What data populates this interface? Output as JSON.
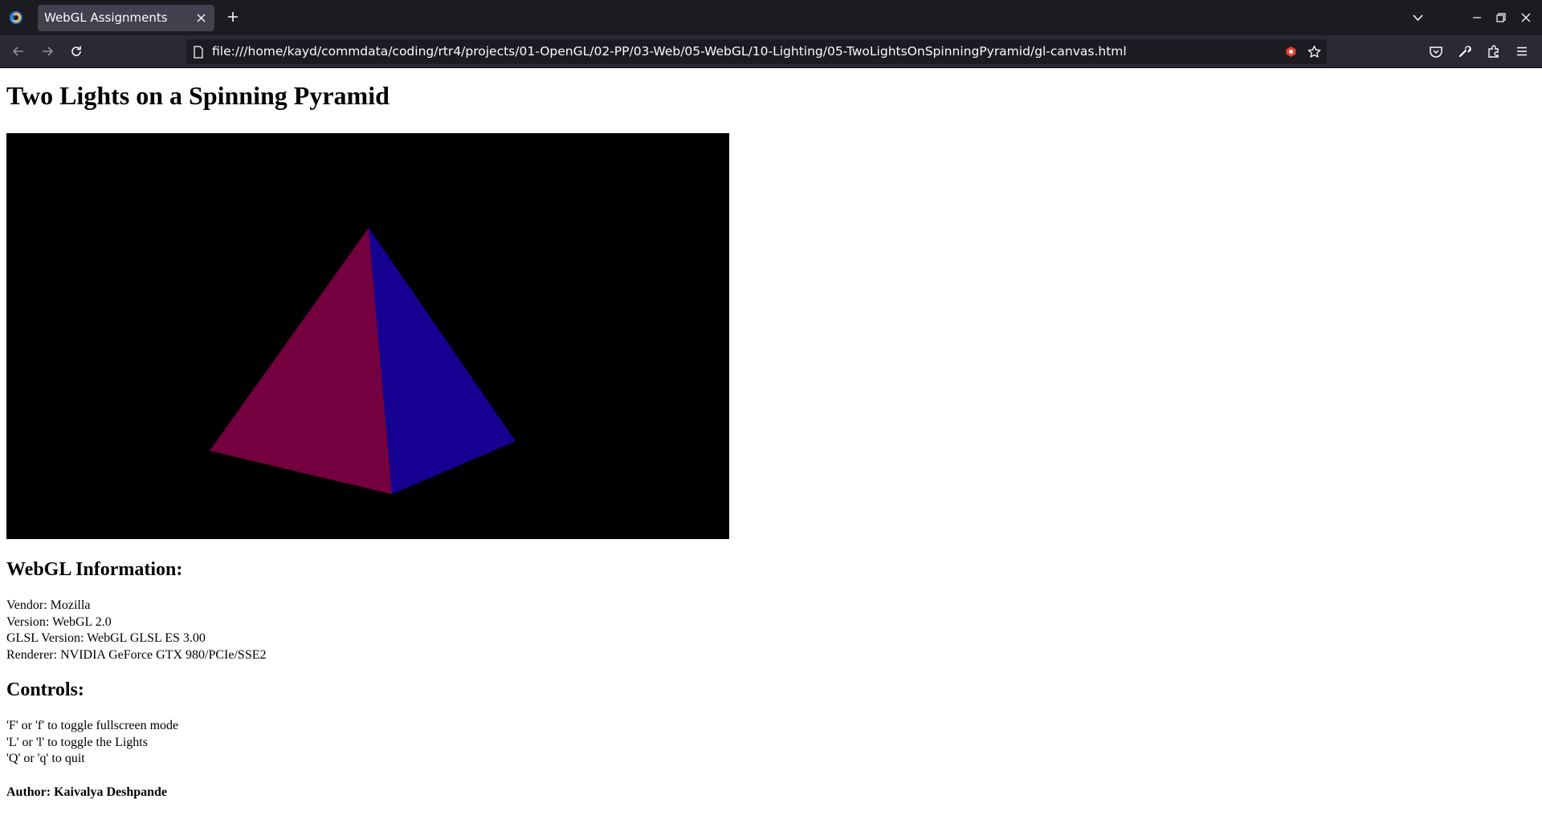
{
  "browser": {
    "tab": {
      "title": "WebGL Assignments"
    },
    "url": "file:///home/kayd/commdata/coding/rtr4/projects/01-OpenGL/02-PP/03-Web/05-WebGL/10-Lighting/05-TwoLightsOnSpinningPyramid/gl-canvas.html",
    "icons": {
      "browser_logo": "firefox-icon",
      "tab_close": "close-icon",
      "new_tab": "plus-icon",
      "list_tabs": "chevron-down-icon",
      "back": "back-arrow-icon",
      "forward": "forward-arrow-icon",
      "reload": "reload-icon",
      "page": "page-icon",
      "extension_badge": "extension-badge-icon",
      "bookmark": "star-icon",
      "pocket": "pocket-icon",
      "tools": "wrench-icon",
      "extensions": "puzzle-icon",
      "menu": "hamburger-menu-icon",
      "minimize": "minimize-icon",
      "restore": "restore-icon",
      "close_window": "close-icon"
    }
  },
  "page": {
    "title": "Two Lights on a Spinning Pyramid",
    "canvas": {
      "background": "#000000",
      "faces": [
        {
          "name": "left-face",
          "color": "#74003f"
        },
        {
          "name": "right-face",
          "color": "#160092"
        }
      ]
    },
    "webgl_info": {
      "heading": "WebGL Information:",
      "lines": [
        "Vendor: Mozilla",
        "Version: WebGL 2.0",
        "GLSL Version: WebGL GLSL ES 3.00",
        "Renderer: NVIDIA GeForce GTX 980/PCIe/SSE2"
      ]
    },
    "controls": {
      "heading": "Controls:",
      "lines": [
        "'F' or 'f' to toggle fullscreen mode",
        "'L' or 'l' to toggle the Lights",
        "'Q' or 'q' to quit"
      ]
    },
    "author": "Author: Kaivalya Deshpande"
  },
  "theme": {
    "tabstrip_bg": "#1c1b22",
    "toolbar_bg": "#2b2a33",
    "active_tab_bg": "#42414d",
    "text_light": "#fbfbfe"
  }
}
